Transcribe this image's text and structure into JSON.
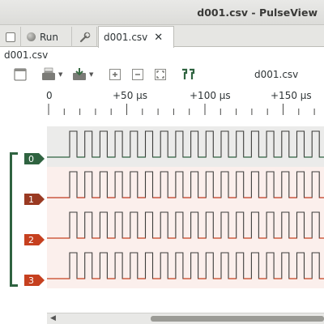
{
  "window": {
    "title": "d001.csv - PulseView"
  },
  "tabs": [
    {
      "label": "",
      "icon": "checkbox-icon"
    },
    {
      "label": "Run",
      "icon": "record-icon"
    },
    {
      "label": "",
      "icon": "wrench-icon"
    },
    {
      "label": "d001.csv",
      "icon": "close-icon",
      "close_glyph": "✕"
    }
  ],
  "session": {
    "label": "d001.csv"
  },
  "toolbar": {
    "buttons": [
      "new-view-icon",
      "open-file-icon",
      "save-icon",
      "zoom-in-icon",
      "zoom-out-icon",
      "zoom-fit-icon",
      "cursor-icon"
    ],
    "device_label": "d001.csv"
  },
  "ruler": {
    "ticks": [
      {
        "label": "0"
      },
      {
        "label": "+50 µs"
      },
      {
        "label": "+100 µs"
      },
      {
        "label": "+150 µs"
      }
    ]
  },
  "channels": [
    {
      "name": "0",
      "color": "#2f6340",
      "trace_color": "#2f6340",
      "bg": "#ebebea"
    },
    {
      "name": "1",
      "color": "#9a3a22",
      "trace_color": "#c0391f",
      "bg": "#fbefec"
    },
    {
      "name": "2",
      "color": "#c6401f",
      "trace_color": "#c6401f",
      "bg": "#fbefec"
    },
    {
      "name": "3",
      "color": "#c6401f",
      "trace_color": "#c6401f",
      "bg": "#fbefec"
    }
  ],
  "colors": {
    "high_line": "#3d3d3b",
    "accent_green": "#2f6340"
  }
}
